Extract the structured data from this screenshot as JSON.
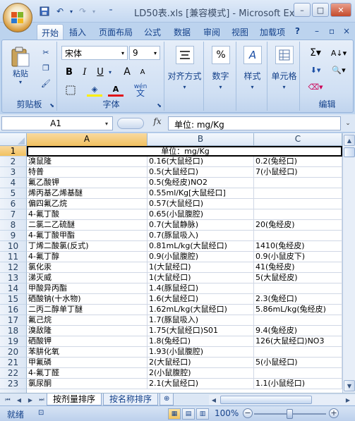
{
  "window": {
    "title": "LD50表.xls [兼容模式] - Microsoft Ex…",
    "min": "–",
    "max": "□",
    "close": "✕"
  },
  "tabs": [
    "开始",
    "插入",
    "页面布局",
    "公式",
    "数据",
    "审阅",
    "视图",
    "加载项"
  ],
  "ribbon": {
    "clipboard": {
      "label": "剪贴板",
      "paste": "粘贴"
    },
    "font": {
      "label": "字体",
      "name": "宋体",
      "size": "9",
      "bold": "B",
      "italic": "I",
      "underline": "U",
      "grow": "A",
      "shrink": "A",
      "phonetic": "wén"
    },
    "alignment": {
      "label": "对齐方式"
    },
    "number": {
      "label": "数字"
    },
    "styles": {
      "label": "样式"
    },
    "cells": {
      "label": "单元格"
    },
    "editing": {
      "label": "编辑"
    }
  },
  "formula_bar": {
    "name_box": "A1",
    "fx": "fx",
    "content": "单位: mg/Kg"
  },
  "columns": [
    "A",
    "B",
    "C"
  ],
  "rows": [
    {
      "n": "1",
      "a": "",
      "b": "单位：mg/Kg",
      "c": ""
    },
    {
      "n": "2",
      "a": "溴鼠隆",
      "b": "0.16(大鼠经口)",
      "c": "0.2(兔经口)"
    },
    {
      "n": "3",
      "a": "特普",
      "b": "0.5(大鼠经口)",
      "c": "7(小鼠经口)"
    },
    {
      "n": "4",
      "a": "氟乙酸钾",
      "b": "0.5(兔经皮)NO2",
      "c": ""
    },
    {
      "n": "5",
      "a": "烯丙基乙烯基醚",
      "b": "0.55ml/Kg[大鼠经口]",
      "c": ""
    },
    {
      "n": "6",
      "a": "偏四氟乙烷",
      "b": "0.57(大鼠经口)",
      "c": ""
    },
    {
      "n": "7",
      "a": "4-氟丁酸",
      "b": "0.65(小鼠腹腔)",
      "c": ""
    },
    {
      "n": "8",
      "a": "二氯二乙硫醚",
      "b": "0.7(大鼠静脉)",
      "c": "20(兔经皮)"
    },
    {
      "n": "9",
      "a": "4-氟丁酸甲酯",
      "b": "0.7(豚鼠吸入)",
      "c": ""
    },
    {
      "n": "10",
      "a": "丁烯二酸氯(反式)",
      "b": "0.81mL/kg(大鼠经口)",
      "c": "1410(兔经皮)"
    },
    {
      "n": "11",
      "a": "4-氟丁醇",
      "b": "0.9(小鼠腹腔)",
      "c": "0.9(小鼠皮下)"
    },
    {
      "n": "12",
      "a": "氯化汞",
      "b": "1(大鼠经口)",
      "c": "41(兔经皮)"
    },
    {
      "n": "13",
      "a": "涕灭威",
      "b": "1(大鼠经口)",
      "c": "5(大鼠经皮)"
    },
    {
      "n": "14",
      "a": "甲酸异丙酯",
      "b": "1.4(豚鼠经口)",
      "c": ""
    },
    {
      "n": "15",
      "a": "硒酸钠(十水物)",
      "b": "1.6(大鼠经口)",
      "c": "2.3(兔经口)"
    },
    {
      "n": "16",
      "a": "二丙二醇单丁醚",
      "b": "1.62mL/kg(大鼠经口)",
      "c": "5.86mL/kg(兔经皮)"
    },
    {
      "n": "17",
      "a": "氟己烷",
      "b": "1.7(豚鼠吸入)",
      "c": ""
    },
    {
      "n": "18",
      "a": "溴敌隆",
      "b": "1.75(大鼠经口)S01",
      "c": "9.4(兔经皮)"
    },
    {
      "n": "19",
      "a": "硒酸钾",
      "b": "1.8(兔经口)",
      "c": "126(大鼠经口)NO3"
    },
    {
      "n": "20",
      "a": "苯肼化氧",
      "b": "1.93(小鼠腹腔)",
      "c": ""
    },
    {
      "n": "21",
      "a": "甲氟磷",
      "b": "2(大鼠经口)",
      "c": "5(小鼠经口)"
    },
    {
      "n": "22",
      "a": "4-氟丁醛",
      "b": "2(小鼠腹腔)",
      "c": ""
    },
    {
      "n": "23",
      "a": "氯尿酮",
      "b": "2.1(大鼠经口)",
      "c": "1.1(小鼠经口)"
    }
  ],
  "sheets": [
    "按剂量排序",
    "按名称排序"
  ],
  "status": {
    "ready": "就绪",
    "zoom": "100%"
  }
}
